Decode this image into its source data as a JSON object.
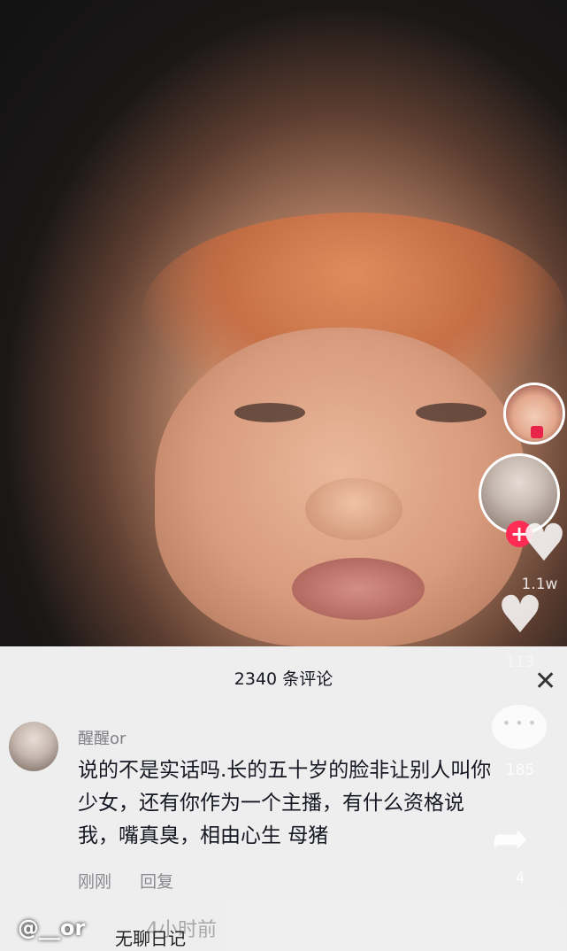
{
  "video": {
    "like_count": "1.1w",
    "comment_count": "113",
    "favorite_count": "185",
    "share_count": "4"
  },
  "comments_sheet": {
    "title": "2340 条评论",
    "close_icon": "close-icon",
    "comment": {
      "username": "醒醒or",
      "text": "说的不是实话吗.长的五十岁的脸非让别人叫你少女，还有你作为一个主播，有什么资格说我，嘴真臭，相由心生  母猪",
      "time": "刚刚",
      "reply_label": "回复"
    }
  },
  "overlay": {
    "handle": "@__or",
    "caption": "无聊日记",
    "time_ghost": "4小时前"
  },
  "colors": {
    "follow_accent": "#fe2c55",
    "sheet_bg": "#f8f8f8"
  }
}
